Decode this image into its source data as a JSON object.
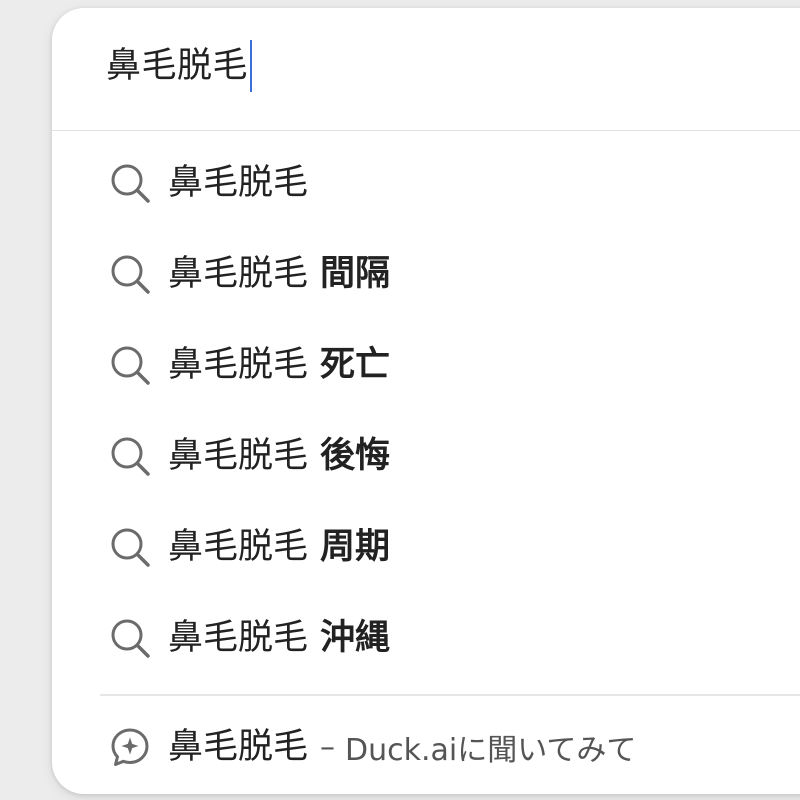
{
  "search": {
    "query": "鼻毛脱毛"
  },
  "suggestions": [
    {
      "query": "鼻毛脱毛",
      "suffix": "",
      "icon": "search-icon"
    },
    {
      "query": "鼻毛脱毛",
      "suffix": "間隔",
      "icon": "search-icon"
    },
    {
      "query": "鼻毛脱毛",
      "suffix": "死亡",
      "icon": "search-icon"
    },
    {
      "query": "鼻毛脱毛",
      "suffix": "後悔",
      "icon": "search-icon"
    },
    {
      "query": "鼻毛脱毛",
      "suffix": "周期",
      "icon": "search-icon"
    },
    {
      "query": "鼻毛脱毛",
      "suffix": "沖縄",
      "icon": "search-icon"
    }
  ],
  "ai_suggestion": {
    "query": "鼻毛脱毛",
    "dash": "–",
    "prompt": "Duck.aiに聞いてみて",
    "icon": "duck-ai-chat-icon"
  },
  "colors": {
    "caret": "#3b6fd8",
    "icon": "#6b6b6b",
    "text": "#222222",
    "secondary_text": "#555555"
  }
}
